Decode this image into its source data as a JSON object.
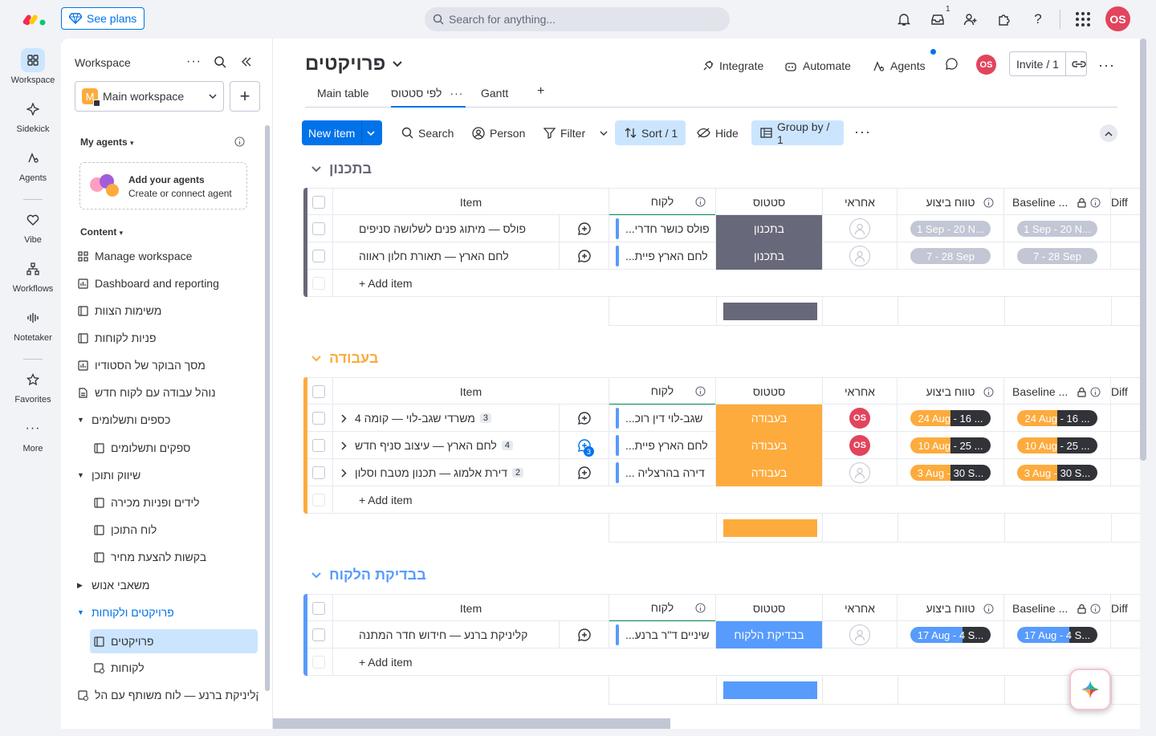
{
  "header": {
    "see_plans": "See plans",
    "search_placeholder": "Search for anything...",
    "inbox_badge": "1",
    "user_initials": "OS"
  },
  "rail": {
    "items": [
      {
        "label": "Workspace",
        "icon": "grid-icon"
      },
      {
        "label": "Sidekick",
        "icon": "sparkle-icon"
      },
      {
        "label": "Agents",
        "icon": "agent-icon"
      },
      {
        "label": "Vibe",
        "icon": "heart-icon"
      },
      {
        "label": "Workflows",
        "icon": "workflow-icon"
      },
      {
        "label": "Notetaker",
        "icon": "waveform-icon"
      },
      {
        "label": "Favorites",
        "icon": "star-icon"
      },
      {
        "label": "More",
        "icon": "more-icon"
      }
    ]
  },
  "sidebar": {
    "title": "Workspace",
    "workspace_name": "Main workspace",
    "workspace_letter": "M",
    "my_agents": "My agents",
    "agent_card_title": "Add your agents",
    "agent_card_sub": "Create or connect agent",
    "content": "Content",
    "items": [
      {
        "label": "Manage workspace"
      },
      {
        "label": "Dashboard and reporting"
      },
      {
        "label": "משימות הצוות"
      },
      {
        "label": "פניות לקוחות"
      },
      {
        "label": "מסך הבוקר של הסטודיו"
      },
      {
        "label": "נוהל עבודה עם לקוח חדש"
      },
      {
        "label": "כספים ותשלומים"
      },
      {
        "label": "ספקים ותשלומים"
      },
      {
        "label": "שיווק ותוכן"
      },
      {
        "label": "לידים ופניות מכירה"
      },
      {
        "label": "לוח התוכן"
      },
      {
        "label": "בקשות להצעת מחיר"
      },
      {
        "label": "משאבי אנוש"
      },
      {
        "label": "פרויקטים ולקוחות"
      },
      {
        "label": "פרויקטים"
      },
      {
        "label": "לקוחות"
      },
      {
        "label": "קליניקת ברנע — לוח משותף עם הל..."
      }
    ]
  },
  "board": {
    "title": "פרויקטים",
    "integrate": "Integrate",
    "automate": "Automate",
    "agents": "Agents",
    "invite": "Invite / 1",
    "tabs": [
      "Main table",
      "לפי סטטוס",
      "Gantt",
      "+"
    ],
    "toolbar": {
      "new_item": "New item",
      "search": "Search",
      "person": "Person",
      "filter": "Filter",
      "sort": "Sort / 1",
      "hide": "Hide",
      "group_by": "Group by / 1"
    },
    "columns": {
      "item": "Item",
      "client": "לקוח",
      "status": "סטטוס",
      "owner": "אחראי",
      "timeline": "טווח ביצוע",
      "baseline": "Baseline ...",
      "diff": "Diff"
    },
    "add_item": "+ Add item",
    "groups": [
      {
        "title": "בתכנון",
        "color": "#676879",
        "rows": [
          {
            "name": "פולס — מיתוג פנים לשלושה סניפים",
            "sub": "",
            "client": "פולס כושר חדרי...",
            "status": "בתכנון",
            "owner": "",
            "timeline": "1 Sep - 20 N...",
            "baseline": "1 Sep - 20 N...",
            "progress": 0,
            "updates": ""
          },
          {
            "name": "לחם הארץ — תאורת חלון ראווה",
            "sub": "",
            "client": "לחם הארץ פיית...",
            "status": "בתכנון",
            "owner": "",
            "timeline": "7 - 28 Sep",
            "baseline": "7 - 28 Sep",
            "progress": 0,
            "updates": ""
          }
        ]
      },
      {
        "title": "בעבודה",
        "color": "#fdab3d",
        "rows": [
          {
            "name": "משרדי שגב-לוי — קומה 4",
            "sub": "3",
            "client": "שגב-לוי דין רוכ...",
            "status": "בעבודה",
            "owner": "OS",
            "timeline": "24 Aug - 16 ...",
            "baseline": "24 Aug - 16 ...",
            "progress": 0.5,
            "updates": ""
          },
          {
            "name": "לחם הארץ — עיצוב סניף חדש",
            "sub": "4",
            "client": "לחם הארץ פיית...",
            "status": "בעבודה",
            "owner": "OS",
            "timeline": "10 Aug - 25 ...",
            "baseline": "10 Aug - 25 ...",
            "progress": 0.5,
            "updates": "3"
          },
          {
            "name": "דירת אלמוג — תכנון מטבח וסלון",
            "sub": "2",
            "client": "דירה בהרצליה ...",
            "status": "בעבודה",
            "owner": "",
            "timeline": "3 Aug - 30 S...",
            "baseline": "3 Aug - 30 S...",
            "progress": 0.5,
            "updates": ""
          }
        ]
      },
      {
        "title": "בבדיקת הלקוח",
        "color": "#579bfc",
        "rows": [
          {
            "name": "קליניקת ברנע — חידוש חדר המתנה",
            "sub": "",
            "client": "שיניים ד\"ר ברנע...",
            "status": "בבדיקת הלקוח",
            "owner": "",
            "timeline": "17 Aug - 4 S...",
            "baseline": "17 Aug - 4 S...",
            "progress": 0.65,
            "updates": ""
          }
        ]
      }
    ]
  },
  "colors": {
    "primary": "#0073ea",
    "planning": "#676879",
    "working": "#fdab3d",
    "review": "#579bfc",
    "avatar": "#e2445c"
  }
}
